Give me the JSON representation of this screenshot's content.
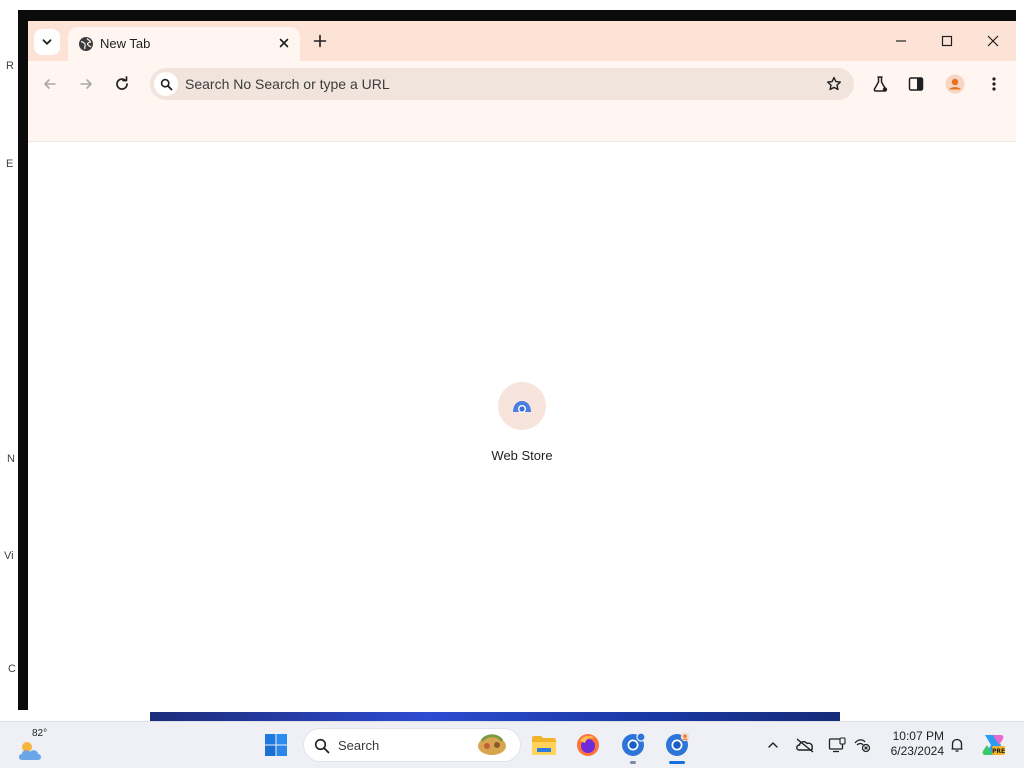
{
  "desktop": {
    "edge_letters": [
      "R",
      "E",
      "N",
      "Vi",
      "C"
    ]
  },
  "browser": {
    "tab": {
      "title": "New Tab"
    },
    "omnibox": {
      "placeholder": "Search No Search or type a URL"
    },
    "shortcuts": [
      {
        "label": "Web Store"
      }
    ],
    "colors": {
      "frame": "#fde3d6",
      "toolbar": "#fff6f1",
      "omnibox": "#f1e4dd",
      "avatar": "#e8711e"
    }
  },
  "taskbar": {
    "weather": {
      "temp": "82°"
    },
    "search": {
      "label": "Search"
    },
    "apps": [
      "start-icon",
      "file-explorer-icon",
      "firefox-icon",
      "chrome-beta-icon",
      "chrome-profile-icon"
    ],
    "tray_icons": [
      "chevron-up-icon",
      "onedrive-offline-icon",
      "display-icon",
      "accessibility-icon",
      "notification-bell-icon",
      "copilot-icon"
    ],
    "clock": {
      "time": "10:07 PM",
      "date": "6/23/2024"
    }
  }
}
